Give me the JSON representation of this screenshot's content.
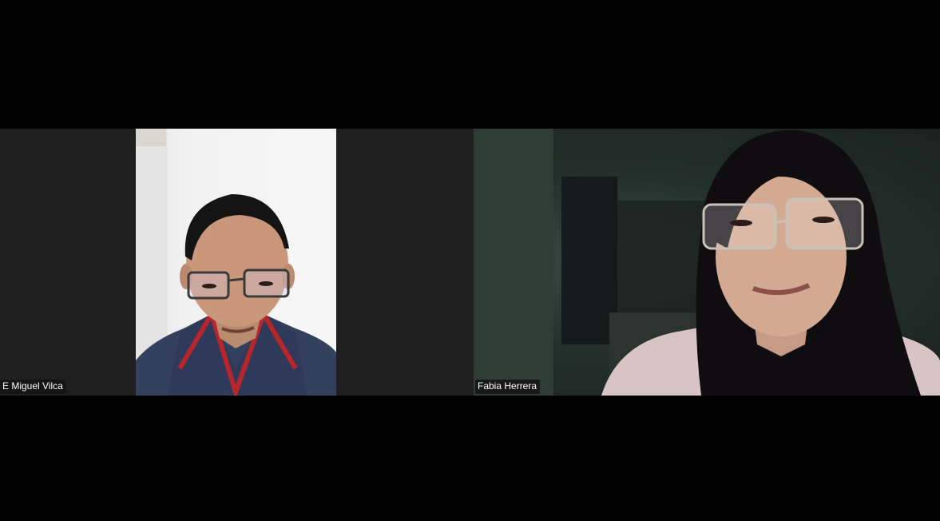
{
  "participants": [
    {
      "name": "E Miguel Vilca",
      "camera_icon": "person-video-icon"
    },
    {
      "name": "Fabia Herrera",
      "camera_icon": "person-video-icon"
    }
  ],
  "colors": {
    "background": "#000000",
    "tile_background": "#1f1f1f",
    "name_tag_background": "#141414",
    "name_tag_text": "#ffffff"
  }
}
